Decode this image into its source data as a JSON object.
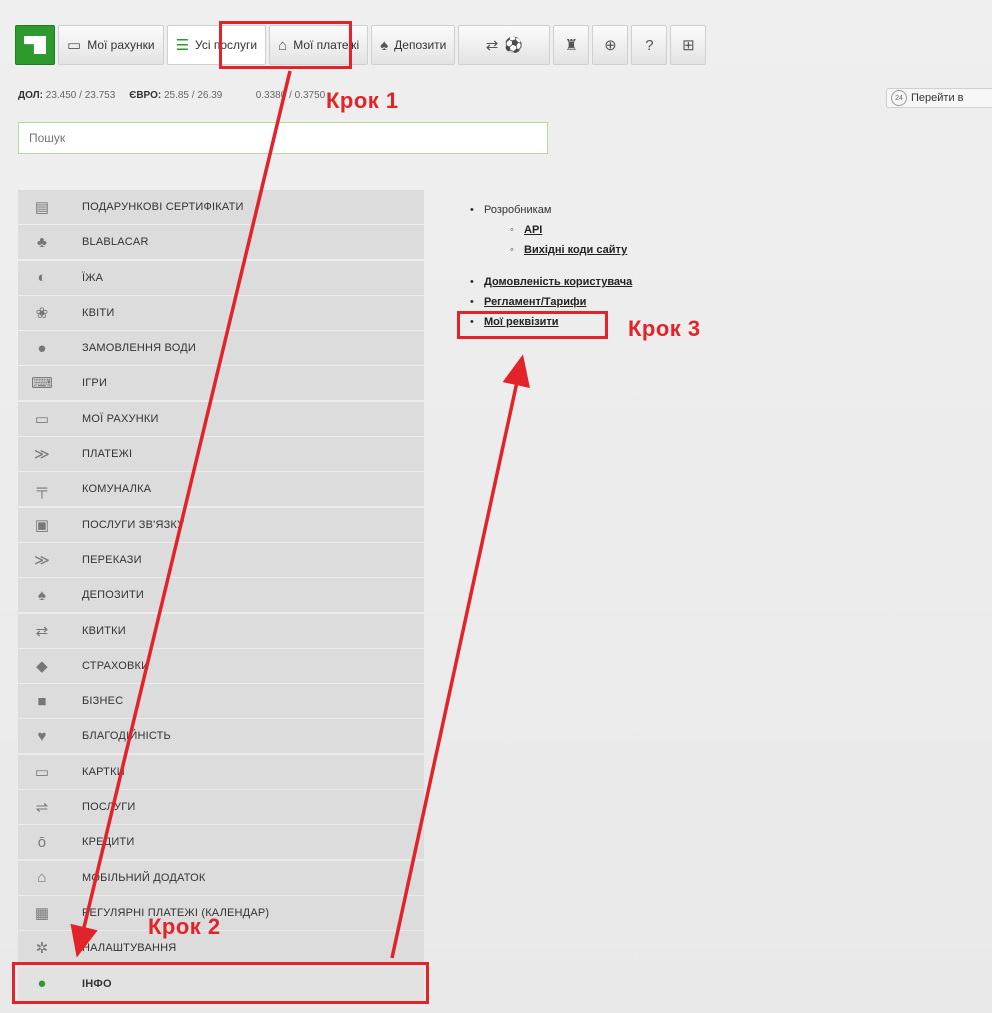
{
  "toolbar": {
    "accounts_label": "Мої рахунки",
    "all_services_label": "Усі послуги",
    "payments_label": "Мої платежі",
    "deposits_label": "Депозити"
  },
  "rates": {
    "usd_label": "ДОЛ:",
    "usd_value": "23.450 / 23.753",
    "eur_label": "ЄВРО:",
    "eur_value": "25.85 / 26.39",
    "rub_value": "0.3380 / 0.3750"
  },
  "goto": {
    "badge": "24",
    "label": "Перейти в"
  },
  "search": {
    "placeholder": "Пошук"
  },
  "sidebar": {
    "items": [
      {
        "label": "ПОДАРУНКОВІ СЕРТИФІКАТИ",
        "icon": "gift-card-icon",
        "glyph": "▤"
      },
      {
        "label": "BLABLACAR",
        "icon": "blablacar-icon",
        "glyph": "♣"
      },
      {
        "label": "ЇЖА",
        "icon": "food-icon",
        "glyph": "◐"
      },
      {
        "label": "КВІТИ",
        "icon": "flower-icon",
        "glyph": "❀"
      },
      {
        "label": "ЗАМОВЛЕННЯ ВОДИ",
        "icon": "water-drop-icon",
        "glyph": "●"
      },
      {
        "label": "ІГРИ",
        "icon": "gamepad-icon",
        "glyph": "⌨"
      },
      {
        "label": "МОЇ РАХУНКИ",
        "icon": "card-icon",
        "glyph": "▭"
      },
      {
        "label": "ПЛАТЕЖІ",
        "icon": "double-chevron-icon",
        "glyph": "≫"
      },
      {
        "label": "КОМУНАЛКА",
        "icon": "faucet-icon",
        "glyph": "╤"
      },
      {
        "label": "ПОСЛУГИ ЗВ'ЯЗКУ",
        "icon": "phone-icon",
        "glyph": "▣"
      },
      {
        "label": "ПЕРЕКАЗИ",
        "icon": "double-chevron-icon",
        "glyph": "≫"
      },
      {
        "label": "ДЕПОЗИТИ",
        "icon": "piggy-bank-icon",
        "glyph": "♠"
      },
      {
        "label": "КВИТКИ",
        "icon": "tickets-icon",
        "glyph": "⇄"
      },
      {
        "label": "СТРАХОВКИ",
        "icon": "shield-icon",
        "glyph": "◆"
      },
      {
        "label": "БІЗНЕС",
        "icon": "briefcase-icon",
        "glyph": "■"
      },
      {
        "label": "БЛАГОДІЙНІСТЬ",
        "icon": "heart-hand-icon",
        "glyph": "♥"
      },
      {
        "label": "КАРТКИ",
        "icon": "card-icon",
        "glyph": "▭"
      },
      {
        "label": "ПОСЛУГИ",
        "icon": "handshake-icon",
        "glyph": "⇌"
      },
      {
        "label": "КРЕДИТИ",
        "icon": "money-bag-icon",
        "glyph": "ō"
      },
      {
        "label": "МОБІЛЬНИЙ ДОДАТОК",
        "icon": "mobile-app-icon",
        "glyph": "⌂"
      },
      {
        "label": "РЕГУЛЯРНІ ПЛАТЕЖІ (КАЛЕНДАР)",
        "icon": "calendar-icon",
        "glyph": "▦"
      },
      {
        "label": "НАЛАШТУВАННЯ",
        "icon": "gear-icon",
        "glyph": "✲"
      },
      {
        "label": "ІНФО",
        "icon": "info-icon",
        "glyph": "●"
      }
    ]
  },
  "content": {
    "developers": "Розробникам",
    "api": "API",
    "source_code": "Вихідні коди сайту",
    "agreement": "Домовленість користувача",
    "tariffs": "Регламент/Тарифи",
    "requisites": "Мої реквізити"
  },
  "annotations": {
    "step1": "Крок 1",
    "step2": "Крок 2",
    "step3": "Крок 3",
    "color": "#e2232a"
  },
  "colors": {
    "brand_green": "#2e9a2e",
    "sidebar_bg": "#dcdcdc"
  }
}
